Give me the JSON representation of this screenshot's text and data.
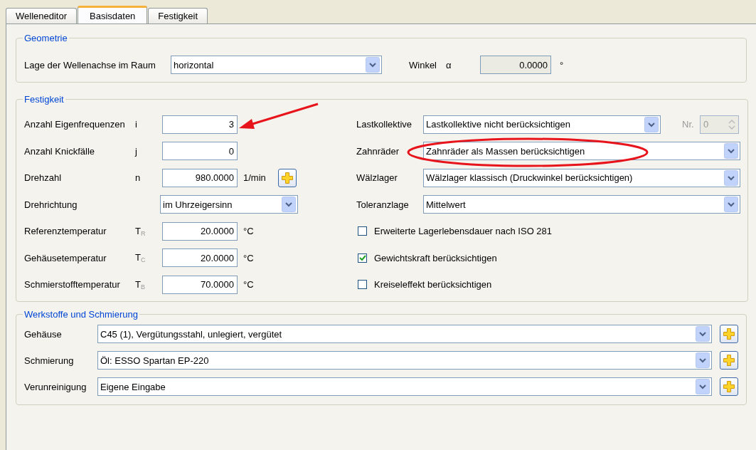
{
  "tabs": [
    {
      "label": "Welleneditor",
      "selected": false
    },
    {
      "label": "Basisdaten",
      "selected": true
    },
    {
      "label": "Festigkeit",
      "selected": false
    }
  ],
  "geometrie": {
    "title": "Geometrie",
    "axis_label": "Lage der Wellenachse im Raum",
    "axis_value": "horizontal",
    "angle_label": "Winkel",
    "angle_symbol": "α",
    "angle_value": "0.0000",
    "angle_disabled": true,
    "angle_unit": "°"
  },
  "festigkeit": {
    "title": "Festigkeit",
    "left_rows": [
      {
        "kind": "input",
        "label": "Anzahl Eigenfrequenzen",
        "symbol": "i",
        "value": "3"
      },
      {
        "kind": "input",
        "label": "Anzahl Knickfälle",
        "symbol": "j",
        "value": "0"
      },
      {
        "kind": "input",
        "label": "Drehzahl",
        "symbol": "n",
        "value": "980.0000",
        "unit": "1/min",
        "add_button": true
      },
      {
        "kind": "select",
        "label": "Drehrichtung",
        "value": "im Uhrzeigersinn"
      },
      {
        "kind": "input",
        "label": "Referenztemperatur",
        "symbol": "T$_{R}$",
        "value": "20.0000",
        "unit": "°C"
      },
      {
        "kind": "input",
        "label": "Gehäusetemperatur",
        "symbol": "T$_{C}$",
        "value": "20.0000",
        "unit": "°C"
      },
      {
        "kind": "input",
        "label": "Schmierstofftemperatur",
        "symbol": "T$_{B}$",
        "value": "70.0000",
        "unit": "°C"
      }
    ],
    "right_rows": [
      {
        "kind": "select",
        "label": "Lastkollektive",
        "value": "Lastkollektive nicht berücksichtigen",
        "nr_label": "Nr.",
        "nr_value": "0",
        "nr_disabled": true
      },
      {
        "kind": "select",
        "label": "Zahnräder",
        "value": "Zahnräder als Massen berücksichtigen"
      },
      {
        "kind": "select",
        "label": "Wälzlager",
        "value": "Wälzlager klassisch (Druckwinkel berücksichtigen)"
      },
      {
        "kind": "select",
        "label": "Toleranzlage",
        "value": "Mittelwert"
      },
      {
        "kind": "checkbox",
        "label": "Erweiterte Lagerlebensdauer nach ISO 281",
        "checked": false
      },
      {
        "kind": "checkbox",
        "label": "Gewichtskraft berücksichtigen",
        "checked": true
      },
      {
        "kind": "checkbox",
        "label": "Kreiseleffekt berücksichtigen",
        "checked": false
      }
    ]
  },
  "werkstoffe": {
    "title": "Werkstoffe und Schmierung",
    "rows": [
      {
        "label": "Gehäuse",
        "value": "C45 (1), Vergütungsstahl, unlegiert, vergütet"
      },
      {
        "label": "Schmierung",
        "value": "Öl: ESSO Spartan EP-220"
      },
      {
        "label": "Verunreinigung",
        "value": "Eigene Eingabe"
      }
    ]
  }
}
